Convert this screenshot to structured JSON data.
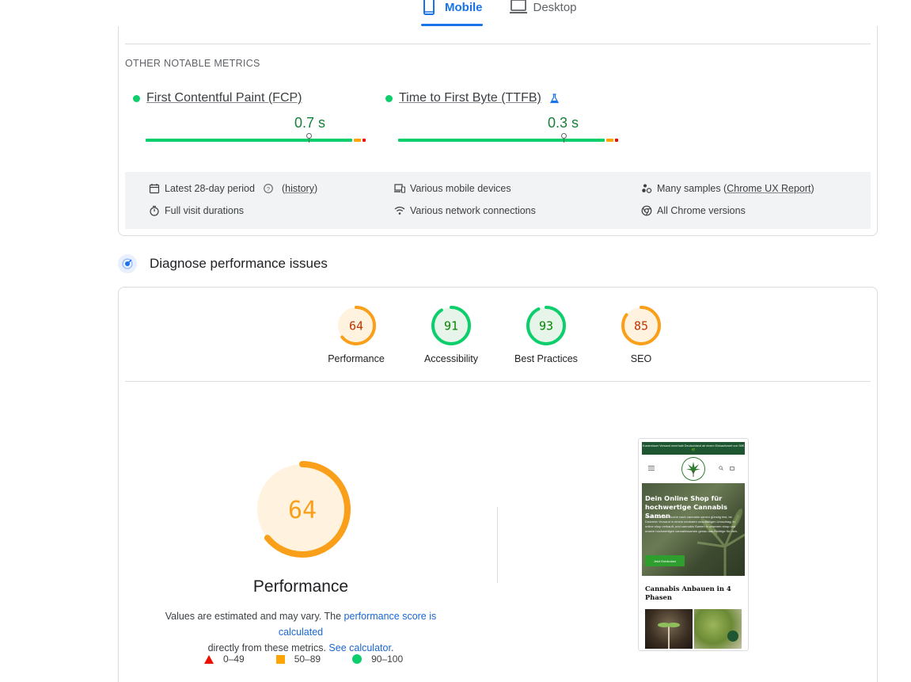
{
  "tabs": [
    {
      "label": "Mobile",
      "icon": "phone-icon",
      "active": true
    },
    {
      "label": "Desktop",
      "icon": "laptop-icon",
      "active": false
    }
  ],
  "field_data": {
    "section_title": "OTHER NOTABLE METRICS",
    "metrics": [
      {
        "name": "First Contentful Paint (FCP)",
        "value": "0.7 s",
        "status_color": "#0cce6b",
        "experimental": false,
        "marker_fraction": 0.74
      },
      {
        "name": "Time to First Byte (TTFB)",
        "value": "0.3 s",
        "status_color": "#0cce6b",
        "experimental": true,
        "marker_fraction": 0.75
      }
    ],
    "info": {
      "period_label": "Latest 28-day period",
      "history_label": "history",
      "visit_durations": "Full visit durations",
      "devices": "Various mobile devices",
      "network": "Various network connections",
      "samples_prefix": "Many samples (",
      "samples_link": "Chrome UX Report",
      "samples_suffix": ")",
      "chrome_versions": "All Chrome versions"
    }
  },
  "diagnose": {
    "title": "Diagnose performance issues"
  },
  "scores": [
    {
      "label": "Performance",
      "value": "64",
      "score": 64,
      "color": "#fa9f1a",
      "text_color": "#c33300",
      "fill": "#fff3e0"
    },
    {
      "label": "Accessibility",
      "value": "91",
      "score": 91,
      "color": "#0cce6b",
      "text_color": "#008800",
      "fill": "#e6f4ea"
    },
    {
      "label": "Best Practices",
      "value": "93",
      "score": 93,
      "color": "#0cce6b",
      "text_color": "#008800",
      "fill": "#e6f4ea"
    },
    {
      "label": "SEO",
      "value": "85",
      "score": 85,
      "color": "#fa9f1a",
      "text_color": "#c33300",
      "fill": "#fff3e0"
    }
  ],
  "performance": {
    "score": "64",
    "score_value": 64,
    "title": "Performance",
    "note_prefix": "Values are estimated and may vary. The",
    "note_link1": "performance score is calculated",
    "note_middle": "directly from these metrics.",
    "note_link2": "See calculator",
    "note_suffix": ".",
    "legend": [
      {
        "shape": "triangle",
        "label": "0–49"
      },
      {
        "shape": "square",
        "label": "50–89"
      },
      {
        "shape": "circle",
        "label": "90–100"
      }
    ]
  },
  "screenshot": {
    "banner": "Kostenloser Versand innerhalb Deutschland ab einem Einkaufswert von 50€ 🌿",
    "hero_title": "Dein Online Shop für hochwertige Cannabis Samen",
    "hero_text": "Wenn du auf der Suche nach cannabis samen günstig bist, ist Diskreter Versand in einem neutralen unauffälligen Umschlag; in online shop verkauft, und cannabis Samen in unserem shop und unsere hochwertigen cannabissamen genau das Richtige für dich.",
    "hero_button": "Jetzt Entdecken",
    "section_title": "Cannabis Anbauen in 4 Phasen"
  }
}
